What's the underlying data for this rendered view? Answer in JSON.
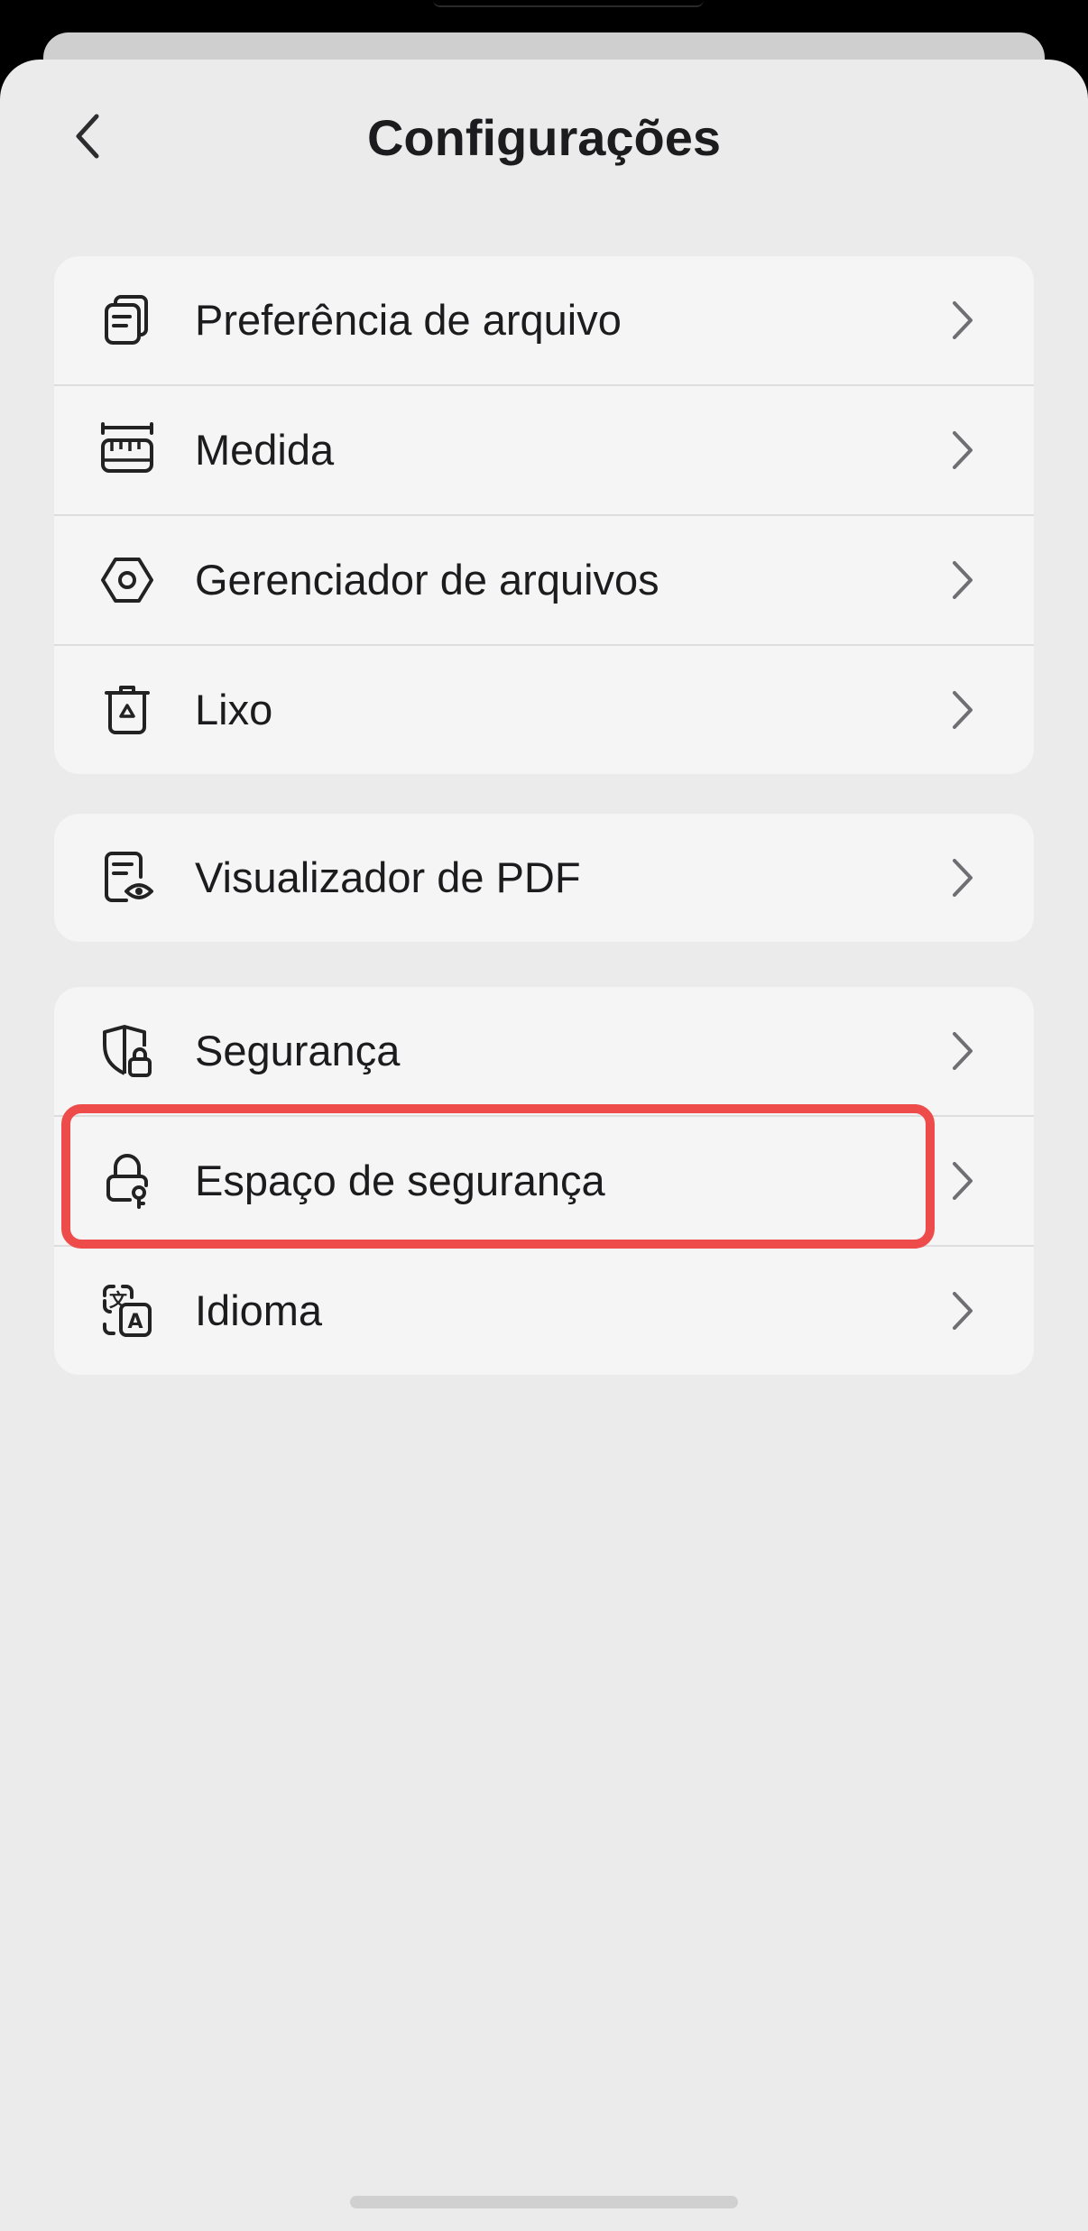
{
  "header": {
    "title": "Configurações",
    "back_icon": "chevron-left-icon"
  },
  "groups": [
    {
      "items": [
        {
          "label": "Preferência de arquivo",
          "icon": "file-stack-icon"
        },
        {
          "label": "Medida",
          "icon": "ruler-icon"
        },
        {
          "label": "Gerenciador de arquivos",
          "icon": "hexagon-icon"
        },
        {
          "label": "Lixo",
          "icon": "trash-icon"
        }
      ]
    },
    {
      "items": [
        {
          "label": "Visualizador de PDF",
          "icon": "document-eye-icon"
        }
      ]
    },
    {
      "items": [
        {
          "label": "Segurança",
          "icon": "shield-lock-icon"
        },
        {
          "label": "Espaço de segurança",
          "icon": "lock-key-icon",
          "highlighted": true
        },
        {
          "label": "Idioma",
          "icon": "translate-icon"
        }
      ]
    }
  ],
  "colors": {
    "highlight": "#ee4b4b",
    "background": "#ebebeb",
    "card": "#f5f5f5",
    "text": "#1c1c1e"
  }
}
